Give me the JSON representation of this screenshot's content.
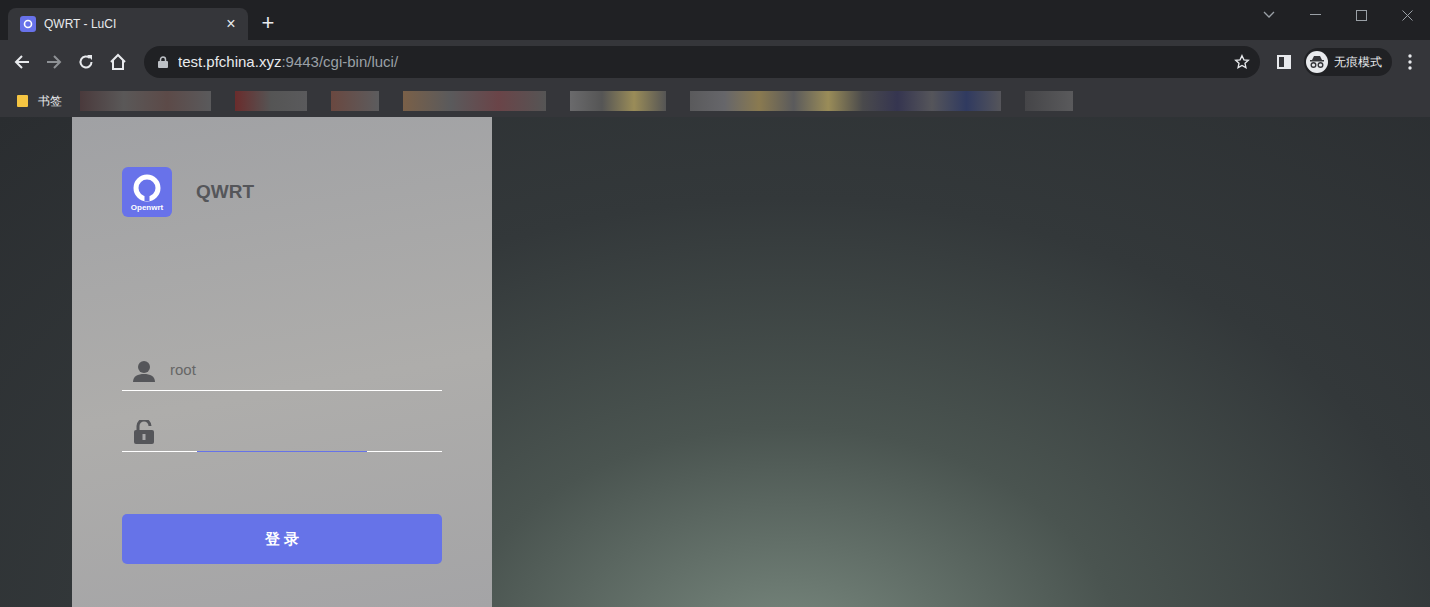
{
  "browser": {
    "tabs": [
      {
        "title": "QWRT - LuCI",
        "close": "×",
        "selected": true
      }
    ],
    "new_tab": "+",
    "address": {
      "host": "test.pfchina.xyz",
      "rest": ":9443/cgi-bin/luci/"
    },
    "profile": "无痕模式",
    "bookmarks_folder": "书签"
  },
  "login": {
    "logo_text": "Openwrt",
    "brand": "QWRT",
    "username": "root",
    "password": "",
    "password_focused": true,
    "button": "登 录"
  }
}
